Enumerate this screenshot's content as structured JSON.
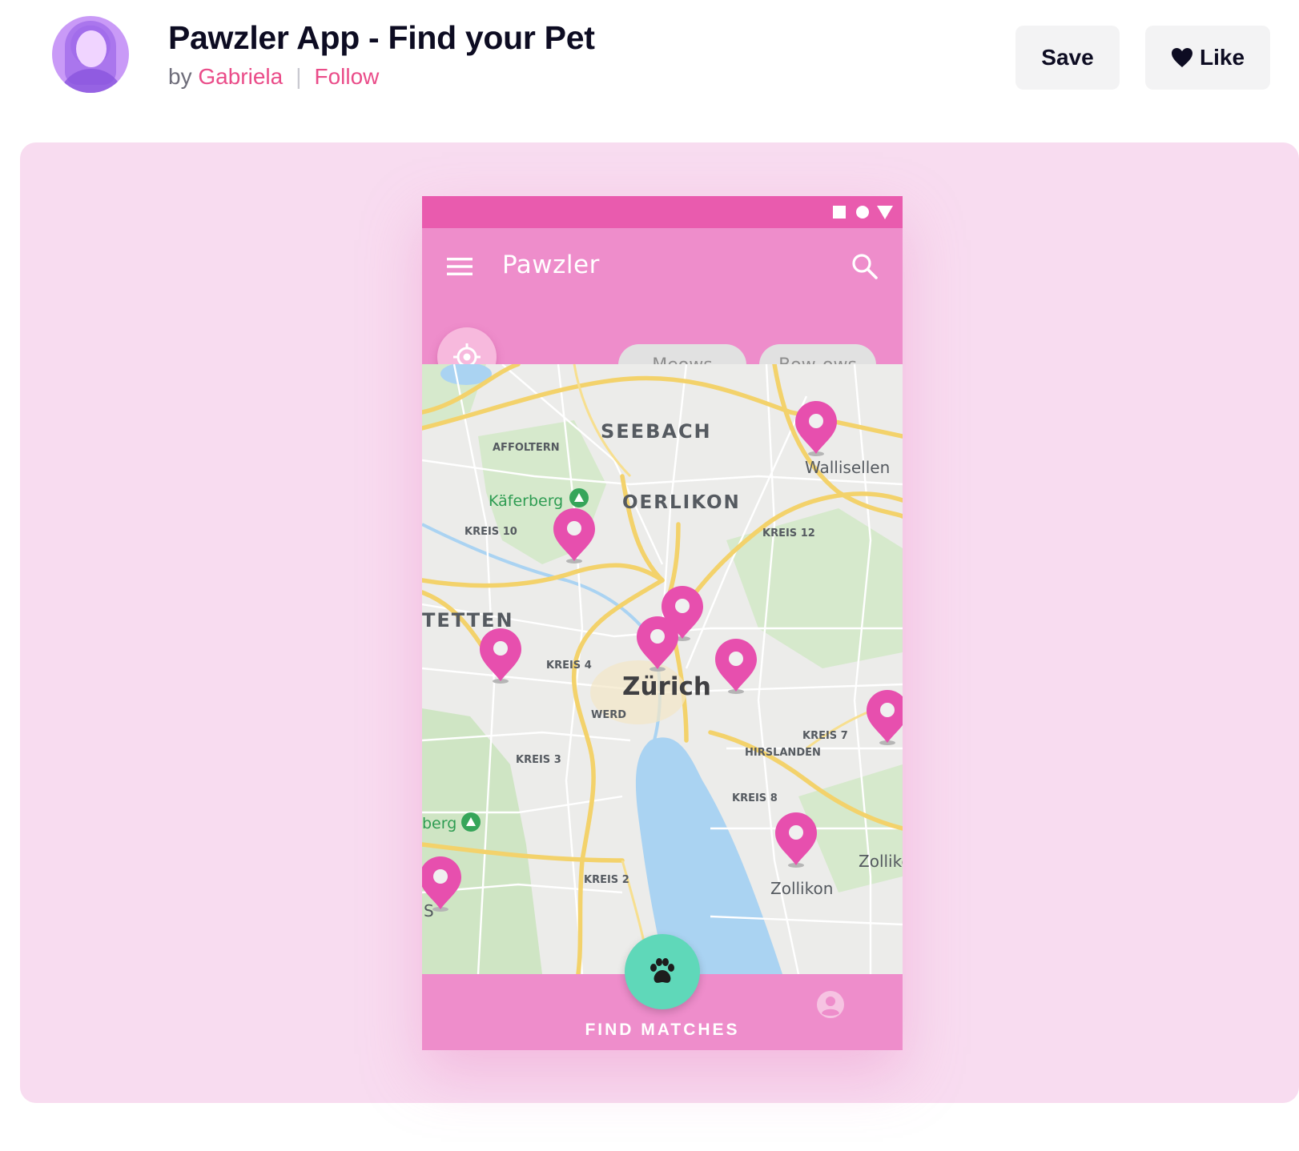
{
  "shot": {
    "title": "Pawzler App - Find your Pet",
    "by_prefix": "by",
    "author": "Gabriela",
    "follow_label": "Follow",
    "save_label": "Save",
    "like_label": "Like"
  },
  "phone": {
    "app_title": "Pawzler",
    "chips": [
      "Meows",
      "Bow-ows"
    ],
    "bottom_label": "FIND MATCHES"
  },
  "map": {
    "labels": {
      "seebach": "SEEBACH",
      "affoltern": "AFFOLTERN",
      "kaferberg": "Käferberg",
      "oerlikon": "OERLIKON",
      "wallisellen": "Wallisellen",
      "kreis10": "KREIS 10",
      "kreis12": "KREIS 12",
      "tetten": "TETTEN",
      "kreis4": "KREIS 4",
      "zurich": "Zürich",
      "werd": "WERD",
      "kreis7": "KREIS 7",
      "hirslanden": "HIRSLANDEN",
      "kreis3": "KREIS 3",
      "kreis8": "KREIS 8",
      "berg": "berg",
      "zollike": "Zollike",
      "kreis2": "KREIS 2",
      "zollikon": "Zollikon",
      "s": "S"
    }
  },
  "colors": {
    "accent": "#ea4c89",
    "panel_bg": "#f8dcf0",
    "status_bar": "#e95bae",
    "app_bar": "#ee8dcb",
    "pin": "#e74fae",
    "fab": "#5fd8b9",
    "water": "#aad3f2"
  }
}
